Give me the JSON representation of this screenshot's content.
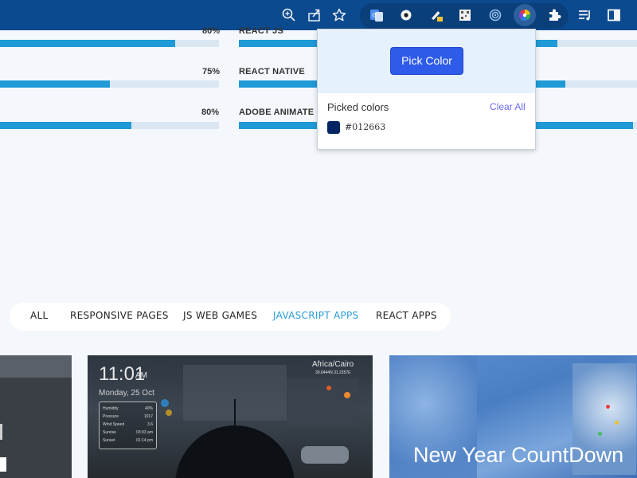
{
  "toolbar": {
    "icons": [
      "zoom-icon",
      "share-icon",
      "bookmark-star-icon",
      "google-translate-extension-icon",
      "record-extension-icon",
      "highlighter-extension-icon",
      "qr-code-extension-icon",
      "target-extension-icon",
      "color-picker-extension-icon",
      "extensions-puzzle-icon",
      "reading-list-icon",
      "side-panel-icon"
    ],
    "bar_color": "#0c4a8f"
  },
  "skills": {
    "left": [
      {
        "percent": "80%",
        "fill": 0.8
      },
      {
        "percent": "75%",
        "fill": 0.5
      },
      {
        "percent": "80%",
        "fill": 0.6
      }
    ],
    "right": [
      {
        "name": "REACT JS",
        "fill": 0.8
      },
      {
        "name": "REACT NATIVE",
        "fill": 0.82
      },
      {
        "name": "ADOBE ANIMATE",
        "fill": 0.99
      }
    ],
    "bar_color": "#1f9ad6",
    "track_color": "#dbe6f3"
  },
  "filters": [
    {
      "label": "ALL",
      "active": false
    },
    {
      "label": "RESPONSIVE PAGES",
      "active": false
    },
    {
      "label": "JS WEB GAMES",
      "active": false
    },
    {
      "label": "JAVASCRIPT APPS",
      "active": true
    },
    {
      "label": "REACT APPS",
      "active": false
    }
  ],
  "cards": {
    "weather": {
      "time": "11:01",
      "ampm": "AM",
      "date": "Monday, 25 Oct",
      "location": "Africa/Cairo",
      "coords": "30.0444N 31.2357E",
      "stats": [
        {
          "label": "Humidity",
          "value": "40%"
        },
        {
          "label": "Pressure",
          "value": "1017"
        },
        {
          "label": "Wind Speed",
          "value": "3.6"
        },
        {
          "label": "Sunrise",
          "value": "03:03 am"
        },
        {
          "label": "Sunset",
          "value": "01:14 pm"
        }
      ]
    },
    "newyear": {
      "title": "New Year CountDown"
    }
  },
  "popup": {
    "pick_label": "Pick Color",
    "picked_title": "Picked colors",
    "clear_label": "Clear All",
    "colors": [
      {
        "hex": "#012663"
      }
    ],
    "accent": "#2e5be9"
  }
}
